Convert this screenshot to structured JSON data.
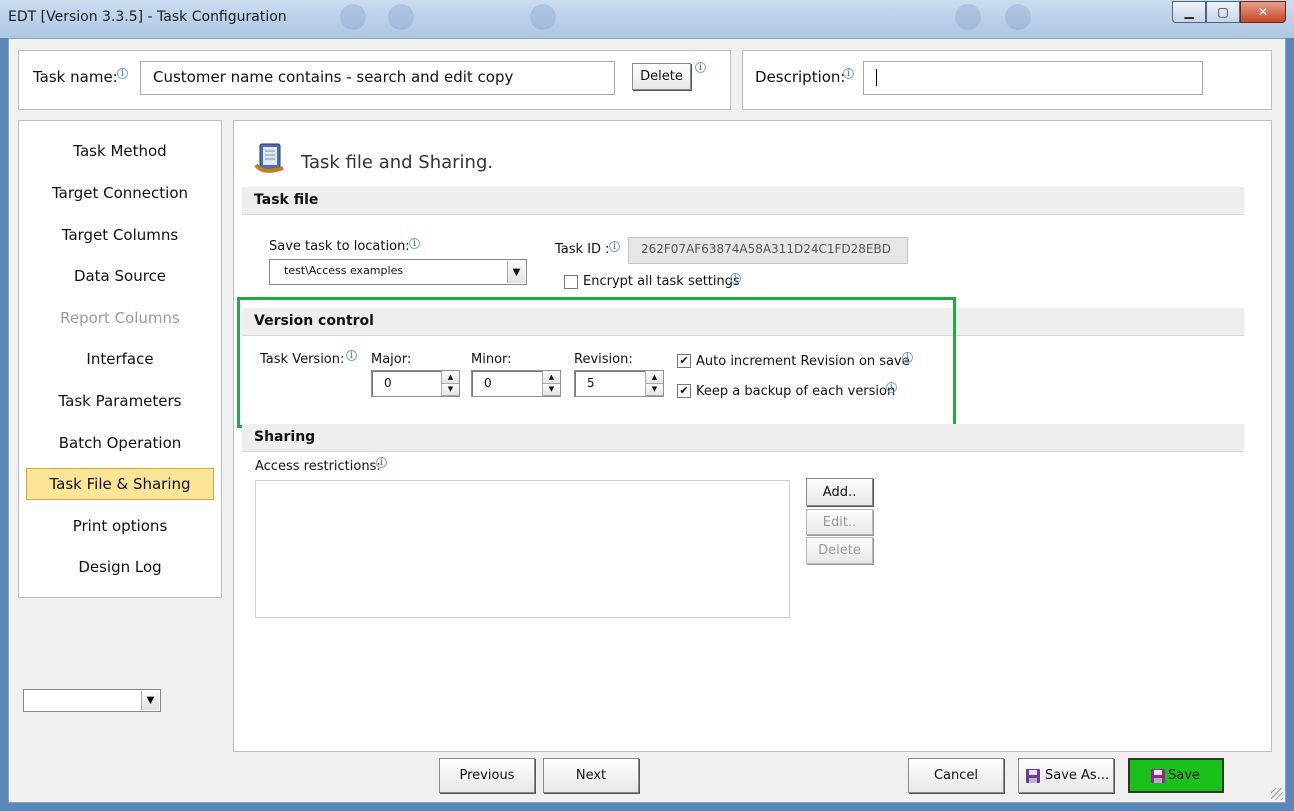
{
  "window": {
    "title": "EDT [Version 3.3.5] - Task Configuration",
    "minimize_glyph": "▁",
    "maximize_glyph": "▢",
    "close_glyph": "✕"
  },
  "header": {
    "task_name_label": "Task name:",
    "task_name_value": "Customer name contains - search and edit copy",
    "delete_label": "Delete",
    "description_label": "Description:",
    "description_value": ""
  },
  "sidebar": {
    "items": [
      {
        "label": "Task Method",
        "state": "normal"
      },
      {
        "label": "Target Connection",
        "state": "normal"
      },
      {
        "label": "Target Columns",
        "state": "normal"
      },
      {
        "label": "Data Source",
        "state": "normal"
      },
      {
        "label": "Report Columns",
        "state": "disabled"
      },
      {
        "label": "Interface",
        "state": "normal"
      },
      {
        "label": "Task Parameters",
        "state": "normal"
      },
      {
        "label": "Batch Operation",
        "state": "normal"
      },
      {
        "label": "Task File & Sharing",
        "state": "active"
      },
      {
        "label": "Print options",
        "state": "normal"
      },
      {
        "label": "Design Log",
        "state": "normal"
      }
    ],
    "bottom_select_value": ""
  },
  "main": {
    "page_title": "Task file and Sharing.",
    "task_file": {
      "heading": "Task file",
      "save_location_label": "Save task to location:",
      "save_location_value": "test\\Access examples",
      "task_id_label": "Task ID :",
      "task_id_value": "262F07AF63874A58A311D24C1FD28EBD",
      "encrypt_label": "Encrypt all task settings",
      "encrypt_checked": false
    },
    "version_control": {
      "heading": "Version control",
      "task_version_label": "Task Version:",
      "major_label": "Major:",
      "major_value": "0",
      "minor_label": "Minor:",
      "minor_value": "0",
      "revision_label": "Revision:",
      "revision_value": "5",
      "auto_increment_label": "Auto increment Revision on save",
      "auto_increment_checked": true,
      "keep_backup_label": "Keep a backup of each version",
      "keep_backup_checked": true,
      "highlight_color": "#22a845"
    },
    "sharing": {
      "heading": "Sharing",
      "access_label": "Access restrictions:",
      "add_label": "Add..",
      "edit_label": "Edit..",
      "delete_label": "Delete"
    }
  },
  "footer": {
    "previous_label": "Previous",
    "next_label": "Next",
    "cancel_label": "Cancel",
    "save_as_label": "Save As...",
    "save_label": "Save",
    "save_color": "#18c218"
  },
  "glyphs": {
    "check": "✔",
    "dropdown": "▼",
    "up": "▲",
    "down": "▼",
    "info": "i"
  }
}
